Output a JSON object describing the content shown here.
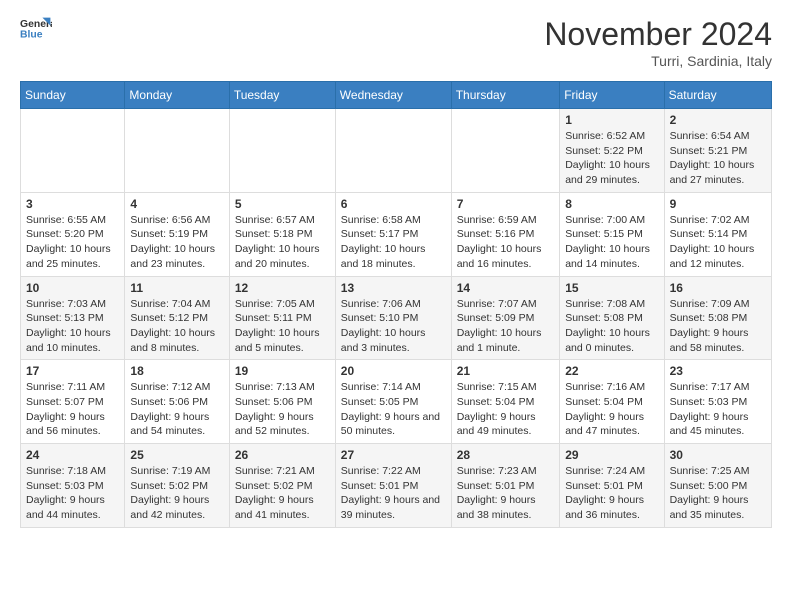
{
  "header": {
    "logo_text1": "General",
    "logo_text2": "Blue",
    "month": "November 2024",
    "location": "Turri, Sardinia, Italy"
  },
  "days_of_week": [
    "Sunday",
    "Monday",
    "Tuesday",
    "Wednesday",
    "Thursday",
    "Friday",
    "Saturday"
  ],
  "weeks": [
    [
      {
        "day": "",
        "info": ""
      },
      {
        "day": "",
        "info": ""
      },
      {
        "day": "",
        "info": ""
      },
      {
        "day": "",
        "info": ""
      },
      {
        "day": "",
        "info": ""
      },
      {
        "day": "1",
        "info": "Sunrise: 6:52 AM\nSunset: 5:22 PM\nDaylight: 10 hours and 29 minutes."
      },
      {
        "day": "2",
        "info": "Sunrise: 6:54 AM\nSunset: 5:21 PM\nDaylight: 10 hours and 27 minutes."
      }
    ],
    [
      {
        "day": "3",
        "info": "Sunrise: 6:55 AM\nSunset: 5:20 PM\nDaylight: 10 hours and 25 minutes."
      },
      {
        "day": "4",
        "info": "Sunrise: 6:56 AM\nSunset: 5:19 PM\nDaylight: 10 hours and 23 minutes."
      },
      {
        "day": "5",
        "info": "Sunrise: 6:57 AM\nSunset: 5:18 PM\nDaylight: 10 hours and 20 minutes."
      },
      {
        "day": "6",
        "info": "Sunrise: 6:58 AM\nSunset: 5:17 PM\nDaylight: 10 hours and 18 minutes."
      },
      {
        "day": "7",
        "info": "Sunrise: 6:59 AM\nSunset: 5:16 PM\nDaylight: 10 hours and 16 minutes."
      },
      {
        "day": "8",
        "info": "Sunrise: 7:00 AM\nSunset: 5:15 PM\nDaylight: 10 hours and 14 minutes."
      },
      {
        "day": "9",
        "info": "Sunrise: 7:02 AM\nSunset: 5:14 PM\nDaylight: 10 hours and 12 minutes."
      }
    ],
    [
      {
        "day": "10",
        "info": "Sunrise: 7:03 AM\nSunset: 5:13 PM\nDaylight: 10 hours and 10 minutes."
      },
      {
        "day": "11",
        "info": "Sunrise: 7:04 AM\nSunset: 5:12 PM\nDaylight: 10 hours and 8 minutes."
      },
      {
        "day": "12",
        "info": "Sunrise: 7:05 AM\nSunset: 5:11 PM\nDaylight: 10 hours and 5 minutes."
      },
      {
        "day": "13",
        "info": "Sunrise: 7:06 AM\nSunset: 5:10 PM\nDaylight: 10 hours and 3 minutes."
      },
      {
        "day": "14",
        "info": "Sunrise: 7:07 AM\nSunset: 5:09 PM\nDaylight: 10 hours and 1 minute."
      },
      {
        "day": "15",
        "info": "Sunrise: 7:08 AM\nSunset: 5:08 PM\nDaylight: 10 hours and 0 minutes."
      },
      {
        "day": "16",
        "info": "Sunrise: 7:09 AM\nSunset: 5:08 PM\nDaylight: 9 hours and 58 minutes."
      }
    ],
    [
      {
        "day": "17",
        "info": "Sunrise: 7:11 AM\nSunset: 5:07 PM\nDaylight: 9 hours and 56 minutes."
      },
      {
        "day": "18",
        "info": "Sunrise: 7:12 AM\nSunset: 5:06 PM\nDaylight: 9 hours and 54 minutes."
      },
      {
        "day": "19",
        "info": "Sunrise: 7:13 AM\nSunset: 5:06 PM\nDaylight: 9 hours and 52 minutes."
      },
      {
        "day": "20",
        "info": "Sunrise: 7:14 AM\nSunset: 5:05 PM\nDaylight: 9 hours and 50 minutes."
      },
      {
        "day": "21",
        "info": "Sunrise: 7:15 AM\nSunset: 5:04 PM\nDaylight: 9 hours and 49 minutes."
      },
      {
        "day": "22",
        "info": "Sunrise: 7:16 AM\nSunset: 5:04 PM\nDaylight: 9 hours and 47 minutes."
      },
      {
        "day": "23",
        "info": "Sunrise: 7:17 AM\nSunset: 5:03 PM\nDaylight: 9 hours and 45 minutes."
      }
    ],
    [
      {
        "day": "24",
        "info": "Sunrise: 7:18 AM\nSunset: 5:03 PM\nDaylight: 9 hours and 44 minutes."
      },
      {
        "day": "25",
        "info": "Sunrise: 7:19 AM\nSunset: 5:02 PM\nDaylight: 9 hours and 42 minutes."
      },
      {
        "day": "26",
        "info": "Sunrise: 7:21 AM\nSunset: 5:02 PM\nDaylight: 9 hours and 41 minutes."
      },
      {
        "day": "27",
        "info": "Sunrise: 7:22 AM\nSunset: 5:01 PM\nDaylight: 9 hours and 39 minutes."
      },
      {
        "day": "28",
        "info": "Sunrise: 7:23 AM\nSunset: 5:01 PM\nDaylight: 9 hours and 38 minutes."
      },
      {
        "day": "29",
        "info": "Sunrise: 7:24 AM\nSunset: 5:01 PM\nDaylight: 9 hours and 36 minutes."
      },
      {
        "day": "30",
        "info": "Sunrise: 7:25 AM\nSunset: 5:00 PM\nDaylight: 9 hours and 35 minutes."
      }
    ]
  ]
}
